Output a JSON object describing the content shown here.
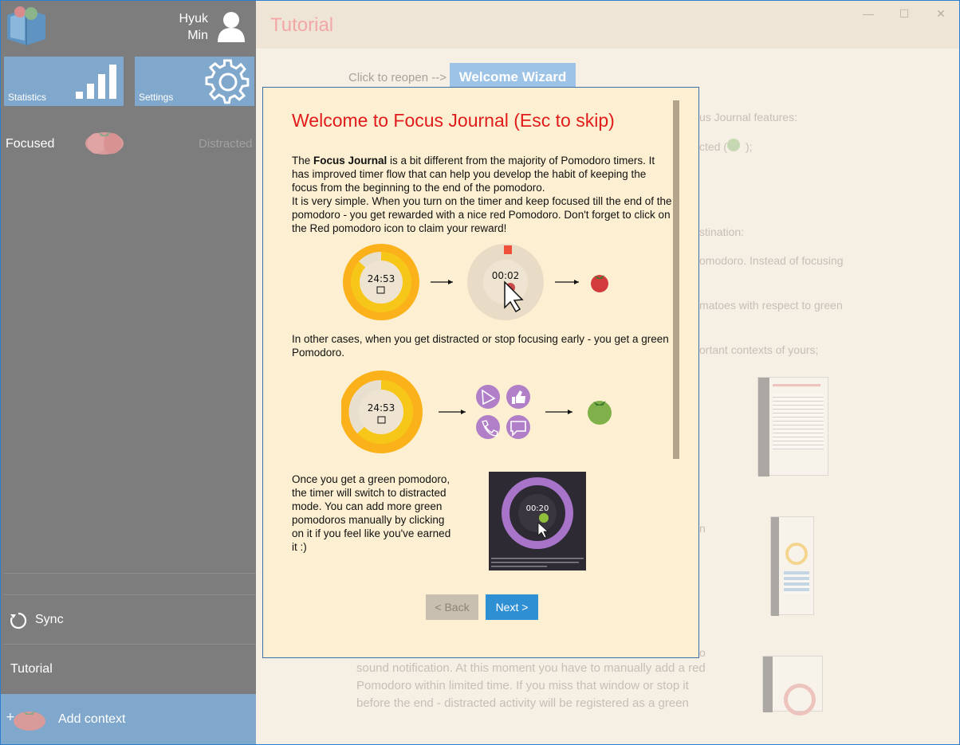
{
  "sidebar": {
    "user": {
      "first_name": "Hyuk",
      "last_name": "Min",
      "icon": "user-icon"
    },
    "tiles": {
      "statistics_label": "Statistics",
      "settings_label": "Settings"
    },
    "focused_label": "Focused",
    "distracted_label": "Distracted",
    "sync_label": "Sync",
    "tutorial_label": "Tutorial",
    "add_context_label": "Add context"
  },
  "main": {
    "title": "Tutorial",
    "reopen_text": "Click to reopen -->",
    "wizard_button": "Welcome Wizard",
    "background_lines": [
      "us Journal features:",
      "cted (",
      ");",
      "stination:",
      "omodoro. Instead of focusing",
      "matoes with respect to green",
      "ortant contexts of yours;",
      "n",
      "o",
      "sound notification. At this moment you have to manually add a red",
      "Pomodoro within limited time. If you miss that window or stop it",
      "before the end - distracted activity will be registered as a green"
    ]
  },
  "dialog": {
    "title": "Welcome to Focus Journal (Esc to skip)",
    "para1_prefix": "The ",
    "para1_bold": "Focus Journal",
    "para1_rest": " is a bit different from the majority of Pomodoro timers. It has improved timer flow that can help you develop the habit of keeping the focus from the beginning to the end of the pomodoro.",
    "para1_line2": "It is very simple. When you turn on the timer and keep focused till the end of the pomodoro - you get rewarded with a nice red Pomodoro. Don't forget to click on the Red pomodoro icon to claim your reward!",
    "fig1_timer": "24:53",
    "fig1_timer2": "00:02",
    "para2": "In other cases, when you get distracted or stop focusing early - you get a green Pomodoro.",
    "fig2_timer": "24:53",
    "para3": "Once you get a green pomodoro, the timer will switch to distracted mode. You can add more green pomodoros manually by clicking on it if you feel like you've earned it :)",
    "fig3_timer": "00:20",
    "back_button": "< Back",
    "next_button": "Next >"
  },
  "colors": {
    "sidebar_bg": "#7d7d7d",
    "tile_bg": "#80a8cc",
    "dialog_bg": "#fdf0d2",
    "title_red": "#e11b1b",
    "next_blue": "#2e8fd3"
  }
}
